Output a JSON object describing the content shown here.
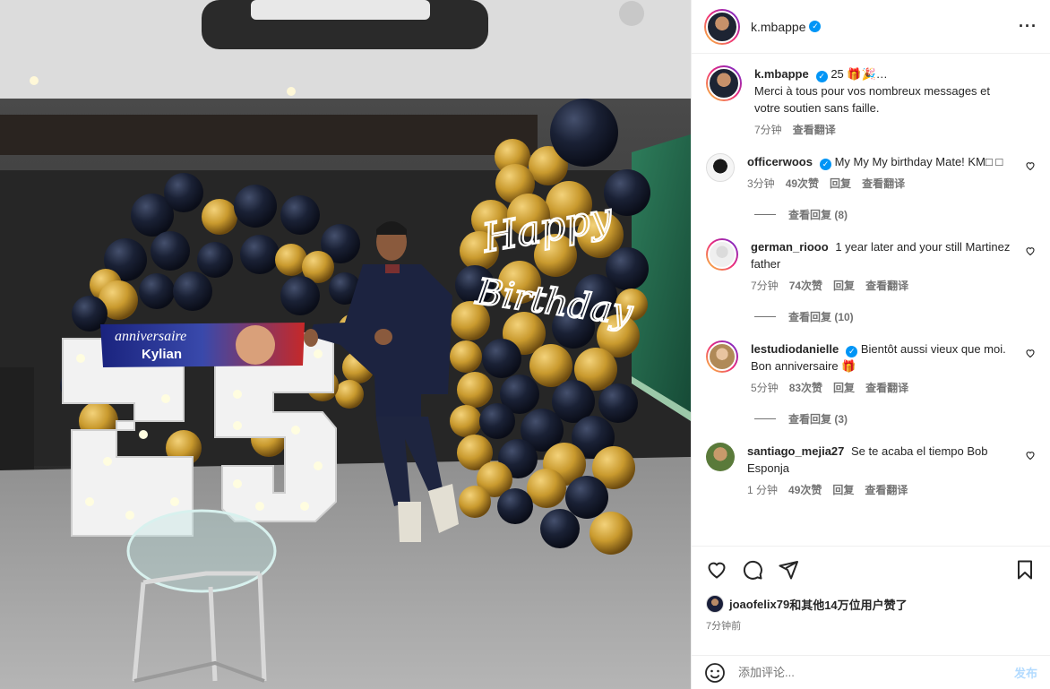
{
  "post": {
    "author": "k.mbappe",
    "caption_title": "25",
    "caption_emoji": "🎁🎉…",
    "caption_text": "Merci à tous pour vos nombreux messages et votre soutien sans faille.",
    "caption_time": "7分钟",
    "caption_translate": "查看翻译"
  },
  "photo": {
    "banner_line1": "anniversaire",
    "banner_line2": "Kylian",
    "neon_line1": "Happy",
    "neon_line2": "Birthday",
    "number": "25"
  },
  "comments": [
    {
      "user": "officerwoos",
      "verified": true,
      "text": "My My My birthday Mate! KM□ □",
      "time": "3分钟",
      "likes": "49次赞",
      "reply": "回复",
      "translate": "查看翻译",
      "view_replies": "查看回复 (8)"
    },
    {
      "user": "german_riooo",
      "verified": false,
      "text": "1 year later and your still Martinez father",
      "time": "7分钟",
      "likes": "74次赞",
      "reply": "回复",
      "translate": "查看翻译",
      "view_replies": "查看回复 (10)"
    },
    {
      "user": "lestudiodanielle",
      "verified": true,
      "text": "Bientôt aussi vieux que moi. Bon anniversaire 🎁",
      "time": "5分钟",
      "likes": "83次赞",
      "reply": "回复",
      "translate": "查看翻译",
      "view_replies": "查看回复 (3)"
    },
    {
      "user": "santiago_mejia27",
      "verified": false,
      "text": "Se te acaba el tiempo Bob Esponja",
      "time": "1 分钟",
      "likes": "49次赞",
      "reply": "回复",
      "translate": "查看翻译",
      "view_replies": ""
    }
  ],
  "likes": {
    "user": "joaofelix79",
    "suffix": "和其他14万位用户赞了"
  },
  "posted_ago": "7分钟前",
  "composer": {
    "placeholder": "添加评论...",
    "post_label": "发布"
  },
  "icons": [
    "smiley-icon",
    "heart-icon",
    "comment-icon",
    "share-icon",
    "bookmark-icon",
    "more-icon",
    "verified-icon"
  ],
  "colors": {
    "accent": "#0095f6",
    "post_disabled": "#b3dbff",
    "muted": "#737373"
  }
}
